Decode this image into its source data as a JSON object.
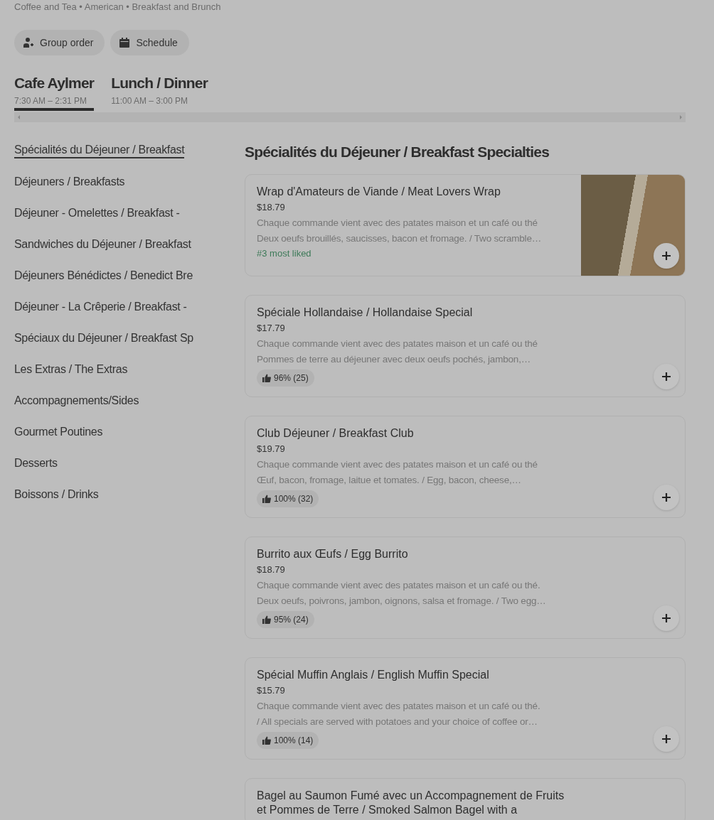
{
  "store": {
    "categories": "Coffee and Tea • American • Breakfast and Brunch"
  },
  "actions": [
    {
      "kind": "group",
      "label": "Group order"
    },
    {
      "kind": "schedule",
      "label": "Schedule"
    }
  ],
  "menus": [
    {
      "name": "Cafe Aylmer",
      "hours": "7:30 AM – 2:31 PM",
      "selected": true
    },
    {
      "name": "Lunch / Dinner",
      "hours": "11:00 AM – 3:00 PM",
      "selected": false
    }
  ],
  "sidebar": {
    "items": [
      {
        "label": "Spécialités du Déjeuner / Breakfast",
        "selected": true
      },
      {
        "label": "Déjeuners / Breakfasts",
        "selected": false
      },
      {
        "label": "Déjeuner - Omelettes / Breakfast -",
        "selected": false
      },
      {
        "label": "Sandwiches du Déjeuner / Breakfast",
        "selected": false
      },
      {
        "label": "Déjeuners Bénédictes / Benedict Bre",
        "selected": false
      },
      {
        "label": "Déjeuner - La Crêperie / Breakfast -",
        "selected": false
      },
      {
        "label": "Spéciaux du Déjeuner / Breakfast Sp",
        "selected": false
      },
      {
        "label": "Les Extras / The Extras",
        "selected": false
      },
      {
        "label": "Accompagnements/Sides",
        "selected": false
      },
      {
        "label": "Gourmet Poutines",
        "selected": false
      },
      {
        "label": "Desserts",
        "selected": false
      },
      {
        "label": "Boissons / Drinks",
        "selected": false
      }
    ]
  },
  "section": {
    "title": "Spécialités du Déjeuner / Breakfast Specialties",
    "items": [
      {
        "name": "Wrap d'Amateurs de Viande / Meat Lovers Wrap",
        "price": "$18.79",
        "description": [
          "Chaque commande vient avec des patates maison et un café ou thé",
          "Deux oeufs brouillés, saucisses, bacon et fromage. / Two scramble…"
        ],
        "badge": {
          "kind": "tag",
          "text": "#3 most liked"
        },
        "photo": true
      },
      {
        "name": "Spéciale Hollandaise / Hollandaise Special",
        "price": "$17.79",
        "description": [
          "Chaque commande vient avec des patates maison et un café ou thé",
          "Pommes de terre au déjeuner avec deux oeufs pochés, jambon,…"
        ],
        "badge": {
          "kind": "rating",
          "text": "96% (25)"
        }
      },
      {
        "name": "Club Déjeuner / Breakfast Club",
        "price": "$19.79",
        "description": [
          "Chaque commande vient avec des patates maison et un café ou thé",
          "Œuf, bacon, fromage, laitue et tomates. / Egg, bacon, cheese,…"
        ],
        "badge": {
          "kind": "rating",
          "text": "100% (32)"
        }
      },
      {
        "name": "Burrito aux Œufs / Egg Burrito",
        "price": "$18.79",
        "description": [
          "Chaque commande vient avec des patates maison et un café ou thé.",
          "Deux oeufs, poivrons, jambon, oignons, salsa et fromage. / Two egg…"
        ],
        "badge": {
          "kind": "rating",
          "text": "95% (24)"
        }
      },
      {
        "name": "Spécial Muffin Anglais / English Muffin Special",
        "price": "$15.79",
        "description": [
          "Chaque commande vient avec des patates maison et un café ou thé.",
          "/ All specials are served with potatoes and your choice of coffee or…"
        ],
        "badge": {
          "kind": "rating",
          "text": "100% (14)"
        }
      },
      {
        "name": "Bagel au Saumon Fumé avec un Accompagnement de Fruits et Pommes de Terre / Smoked Salmon Bagel with a"
      }
    ]
  }
}
